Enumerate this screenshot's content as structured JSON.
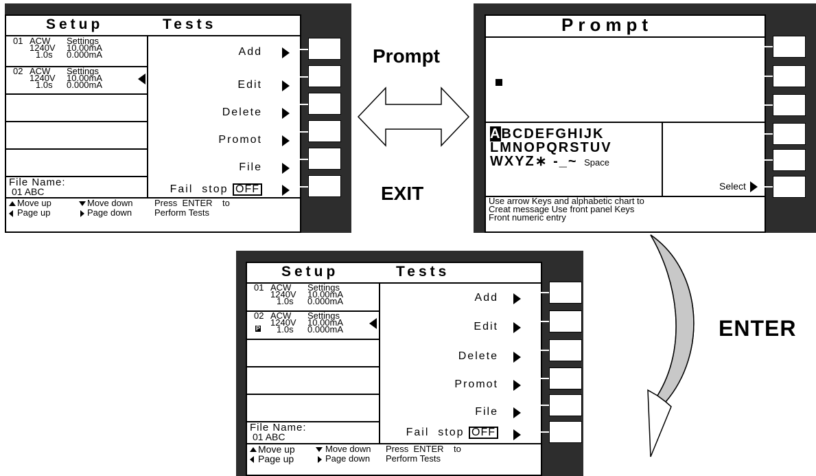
{
  "setup_screen": {
    "title_left": "Setup",
    "title_right": "Tests",
    "steps": [
      {
        "num": "01",
        "type": "ACW",
        "settings": "Settings",
        "voltage": "1240V",
        "current": "10.00mA",
        "time": "1.0s",
        "low": "0.000mA"
      },
      {
        "num": "02",
        "type": "ACW",
        "settings": "Settings",
        "voltage": "1240V",
        "current": "10.00mA",
        "time": "1.0s",
        "low": "0.000mA"
      }
    ],
    "menu": [
      "Add",
      "Edit",
      "Delete",
      "Promot",
      "File"
    ],
    "fail_stop_label": "Fail  stop",
    "fail_stop_value": "OFF",
    "file_name_label": "File  Name:",
    "file_name_value": "01   ABC",
    "nav": {
      "move_up": "Move up",
      "move_down": "Move down",
      "page_up": "Page up",
      "page_down": "Page down",
      "press_enter": "Press  ENTER    to",
      "perform": "Perform Tests"
    },
    "prompt_marker": "P"
  },
  "prompt_screen": {
    "title": "Prompt",
    "alphabet_first": "A",
    "alphabet_row1_rest": "BCDEFGHIJK",
    "alphabet_row2": "LMNOPQRSTUV",
    "alphabet_row3": "WXYZ∗ -_~",
    "space_label": "Space",
    "select_label": "Select",
    "help_line1": "Use arrow Keys and alphabetic chart to",
    "help_line2": "Creat message Use front panel Keys",
    "help_line3": "Front numeric entry"
  },
  "labels": {
    "prompt": "Prompt",
    "exit": "EXIT",
    "enter": "ENTER"
  }
}
